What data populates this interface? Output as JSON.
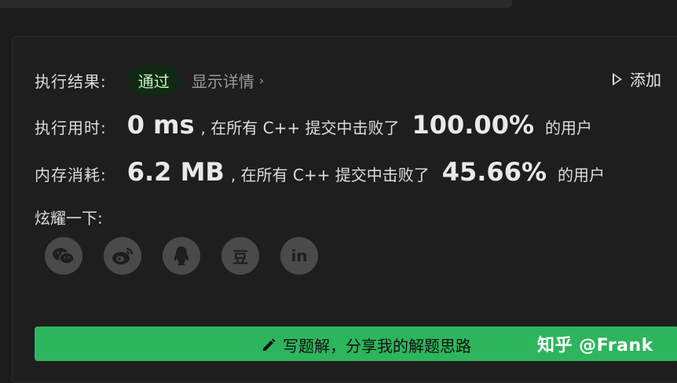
{
  "result": {
    "label": "执行结果:",
    "status": "通过",
    "details": "显示详情",
    "add_label": "添加"
  },
  "runtime": {
    "label": "执行用时:",
    "value": "0 ms",
    "text": ", 在所有 C++ 提交中击败了",
    "percent": "100.00%",
    "suffix": "的用户"
  },
  "memory": {
    "label": "内存消耗:",
    "value": "6.2 MB",
    "text": ", 在所有 C++ 提交中击败了",
    "percent": "45.66%",
    "suffix": "的用户"
  },
  "share": {
    "label": "炫耀一下:",
    "icons": [
      "wechat-icon",
      "weibo-icon",
      "qq-icon",
      "douban-icon",
      "linkedin-icon"
    ],
    "douban_glyph": "豆",
    "linkedin_glyph": "in"
  },
  "write_solution": {
    "label": "写题解，分享我的解题思路"
  },
  "watermark": "知乎 @Frank",
  "colors": {
    "accent_green": "#2db55d",
    "badge_bg": "#0f2a12",
    "badge_text": "#c7f7c1"
  }
}
